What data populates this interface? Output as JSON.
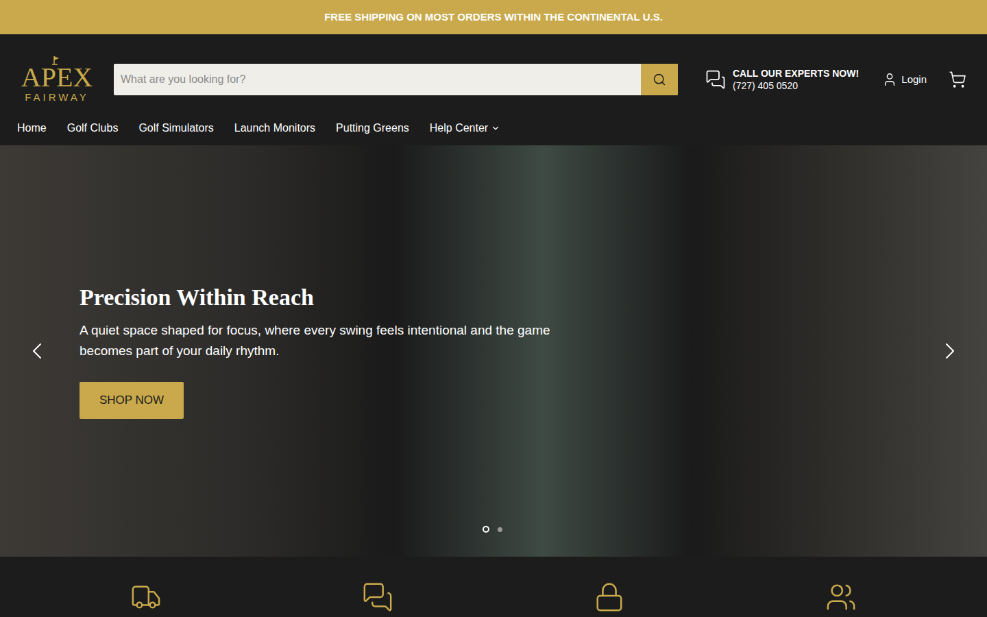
{
  "announcement": "FREE SHIPPING ON MOST ORDERS WITHIN THE CONTINENTAL U.S.",
  "logo": {
    "top": "APEX",
    "bottom": "FAIRWAY"
  },
  "search": {
    "placeholder": "What are you looking for?"
  },
  "contact": {
    "title": "CALL OUR EXPERTS NOW!",
    "phone": "(727) 405 0520"
  },
  "login": "Login",
  "nav": [
    {
      "label": "Home",
      "dropdown": false
    },
    {
      "label": "Golf Clubs",
      "dropdown": false
    },
    {
      "label": "Golf Simulators",
      "dropdown": false
    },
    {
      "label": "Launch Monitors",
      "dropdown": false
    },
    {
      "label": "Putting Greens",
      "dropdown": false
    },
    {
      "label": "Help Center",
      "dropdown": true
    }
  ],
  "hero": {
    "title": "Precision Within Reach",
    "text": "A quiet space shaped for focus, where every swing feels intentional and the game becomes part of your daily rhythm.",
    "button": "SHOP NOW"
  },
  "slides": [
    {
      "selected": true
    },
    {
      "selected": false
    }
  ]
}
